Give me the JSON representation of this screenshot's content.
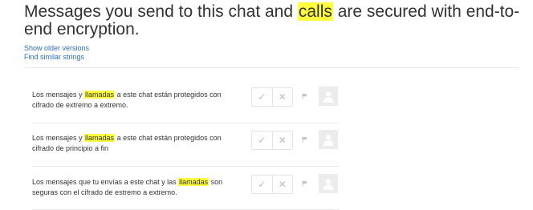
{
  "source": {
    "text_before": "Messages you send to this chat and ",
    "highlight": "calls",
    "text_after": " are secured with end-to-end encryption."
  },
  "links": {
    "show_older": "Show older versions",
    "find_similar": "Find similar strings"
  },
  "suggestions": [
    {
      "before": "Los mensajes y ",
      "highlight": "llamadas",
      "after": " a este chat están protegidos con cifrado de extremo a extremo."
    },
    {
      "before": "Los mensajes y ",
      "highlight": "llamadas",
      "after": " a este chat están protegidos con cifrado de principio a fin"
    },
    {
      "before": "Los mensajes que tu envías a este chat y las ",
      "highlight": "llamadas",
      "after": " son seguras con el cifrado de estremo a extremo."
    }
  ],
  "icons": {
    "approve": "checkmark-icon",
    "reject": "x-icon",
    "flag": "flag-icon",
    "avatar": "user-avatar-icon"
  },
  "colors": {
    "highlight": "#ffff3d",
    "link": "#2a6fb7",
    "button_icon": "#bdbdbd"
  }
}
